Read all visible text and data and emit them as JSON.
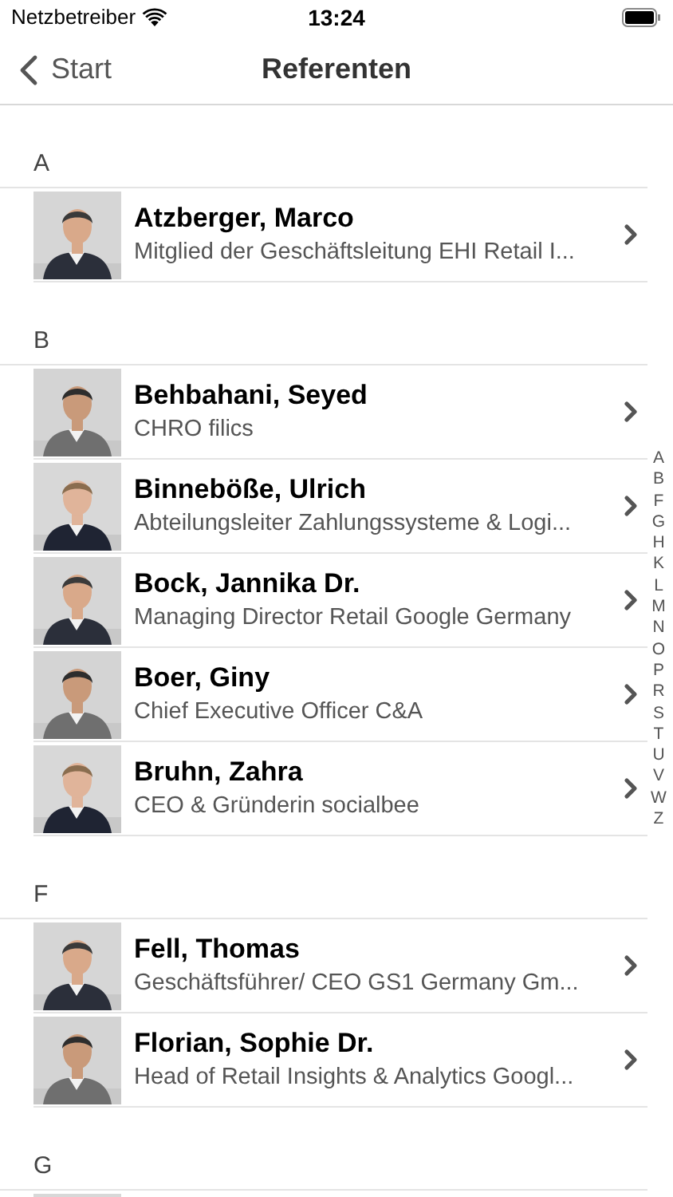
{
  "status_bar": {
    "carrier": "Netzbetreiber",
    "time": "13:24"
  },
  "nav": {
    "back": "Start",
    "title": "Referenten"
  },
  "sections": [
    {
      "letter": "A",
      "people": [
        {
          "name": "Atzberger, Marco",
          "role": "Mitglied der Geschäftsleitung EHI Retail I..."
        }
      ]
    },
    {
      "letter": "B",
      "people": [
        {
          "name": "Behbahani, Seyed",
          "role": "CHRO filics"
        },
        {
          "name": "Binneböße, Ulrich",
          "role": "Abteilungsleiter Zahlungssysteme & Logi..."
        },
        {
          "name": "Bock, Jannika Dr.",
          "role": "Managing Director Retail Google Germany"
        },
        {
          "name": "Boer, Giny",
          "role": "Chief Executive Officer C&A"
        },
        {
          "name": "Bruhn, Zahra",
          "role": "CEO & Gründerin socialbee"
        }
      ]
    },
    {
      "letter": "F",
      "people": [
        {
          "name": "Fell, Thomas",
          "role": "Geschäftsführer/ CEO GS1 Germany Gm..."
        },
        {
          "name": "Florian, Sophie Dr.",
          "role": "Head of Retail Insights & Analytics Googl..."
        }
      ]
    },
    {
      "letter": "G"
    }
  ],
  "index": [
    "A",
    "B",
    "F",
    "G",
    "H",
    "K",
    "L",
    "M",
    "N",
    "O",
    "P",
    "R",
    "S",
    "T",
    "U",
    "V",
    "W",
    "Z"
  ]
}
